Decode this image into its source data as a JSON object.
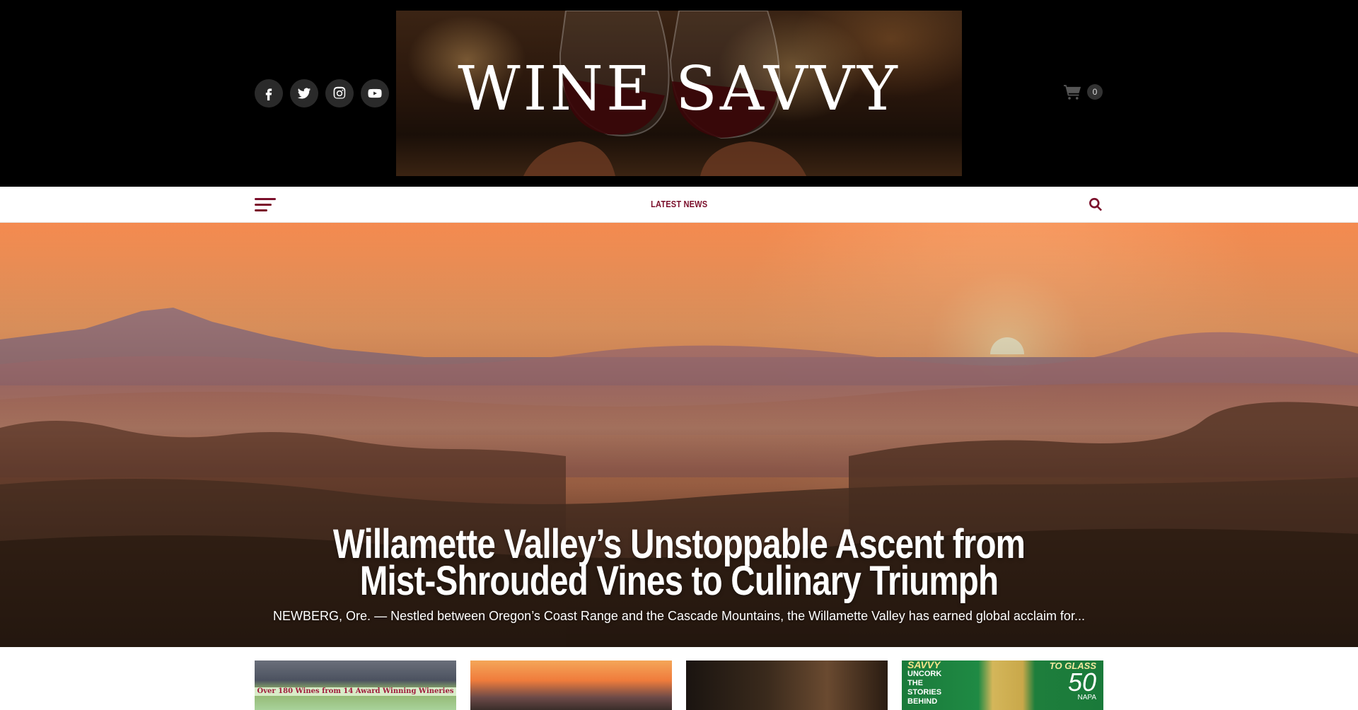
{
  "site": {
    "title": "WINE SAVVY"
  },
  "social": [
    {
      "name": "facebook-icon"
    },
    {
      "name": "twitter-icon"
    },
    {
      "name": "instagram-icon"
    },
    {
      "name": "youtube-icon"
    }
  ],
  "cart": {
    "icon": "shopping-cart-icon",
    "count": "0"
  },
  "nav": {
    "menu_icon": "hamburger-menu-icon",
    "link": "LATEST NEWS",
    "search_icon": "search-icon"
  },
  "hero": {
    "title": "Willamette Valley’s Unstoppable Ascent from Mist-Shrouded Vines to Culinary Triumph",
    "excerpt": "NEWBERG, Ore. — Nestled between Oregon’s Coast Range and the Cascade Mountains, the Willamette Valley has earned global acclaim for..."
  },
  "cards": [
    {
      "strip_text": "Over 180 Wines from 14 Award Winning Wineries"
    },
    {},
    {},
    {
      "left_heading": "SAVVY",
      "left_lines": [
        "UNCORK",
        "THE",
        "STORIES",
        "BEHIND"
      ],
      "right_small": "TO GLASS",
      "right_big": "50",
      "right_tiny": "NAPA"
    }
  ],
  "colors": {
    "accent": "#7b0f2b",
    "header_bg": "#000000"
  }
}
